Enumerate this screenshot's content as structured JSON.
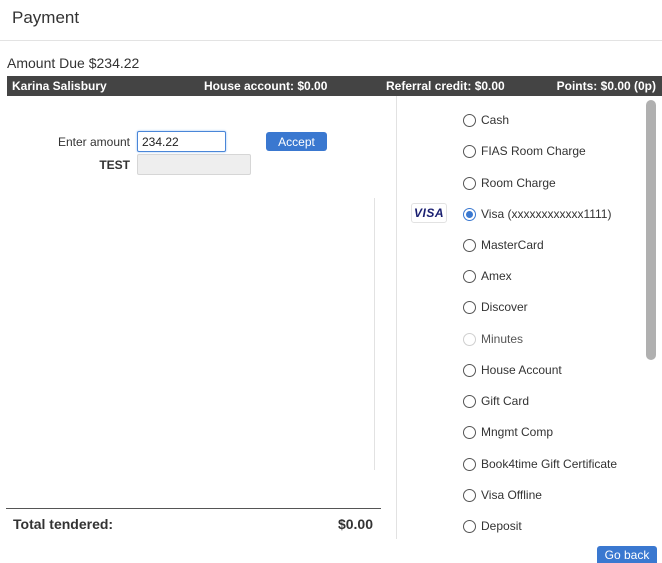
{
  "page": {
    "title": "Payment"
  },
  "amount_due": "Amount Due $234.22",
  "info_bar": {
    "customer_name": "Karina Salisbury",
    "house_account": "House account: $0.00",
    "referral_credit": "Referral credit: $0.00",
    "points": "Points: $0.00 (0p)"
  },
  "entry": {
    "enter_amount_label": "Enter amount",
    "amount_value": "234.22",
    "test_label": "TEST",
    "test_value": "",
    "accept_label": "Accept"
  },
  "payment_methods": [
    {
      "label": "Cash",
      "state": "unchecked"
    },
    {
      "label": "FIAS Room Charge",
      "state": "unchecked"
    },
    {
      "label": "Room Charge",
      "state": "unchecked"
    },
    {
      "label": "Visa (xxxxxxxxxxxx1111)",
      "state": "checked",
      "logo": "VISA"
    },
    {
      "label": "MasterCard",
      "state": "unchecked"
    },
    {
      "label": "Amex",
      "state": "unchecked"
    },
    {
      "label": "Discover",
      "state": "unchecked"
    },
    {
      "label": "Minutes",
      "state": "disabled"
    },
    {
      "label": "House Account",
      "state": "unchecked"
    },
    {
      "label": "Gift Card",
      "state": "unchecked"
    },
    {
      "label": "Mngmt Comp",
      "state": "unchecked"
    },
    {
      "label": "Book4time Gift Certificate",
      "state": "unchecked"
    },
    {
      "label": "Visa Offline",
      "state": "unchecked"
    },
    {
      "label": "Deposit",
      "state": "unchecked"
    }
  ],
  "totals": {
    "label": "Total tendered:",
    "value": "$0.00"
  },
  "footer": {
    "go_back_label": "Go back"
  },
  "colors": {
    "accent": "#3a78d0",
    "info_bar_bg": "#444444"
  },
  "icons": {
    "card_brand_logo": "visa-logo-icon"
  }
}
